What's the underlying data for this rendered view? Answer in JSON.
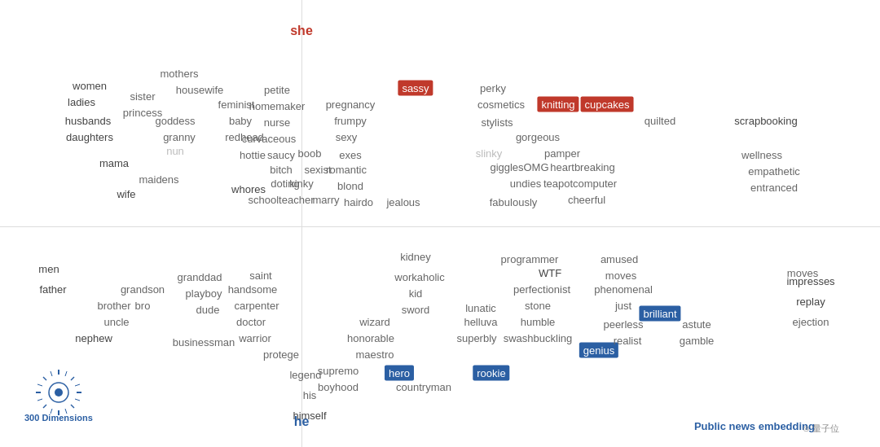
{
  "words": {
    "she": "she",
    "he": "he"
  },
  "watermark": {
    "label": "300\nDimensions"
  },
  "source": {
    "label": "Public news embedding"
  },
  "female_words": [
    "women",
    "ladies",
    "husbands",
    "daughters",
    "sister",
    "princess",
    "mama",
    "mothers",
    "housewife",
    "goddess",
    "granny",
    "nun",
    "maidens",
    "wife",
    "whores",
    "feminist",
    "baby",
    "redhead",
    "hottie",
    "petite",
    "homemaker",
    "nurse",
    "curvaceous",
    "saucy",
    "bitch",
    "doting",
    "schoolteacher",
    "sexist",
    "kinky",
    "marry",
    "pregnancy",
    "frumpy",
    "sexy",
    "exes",
    "romantic",
    "blond",
    "hairdo",
    "boob",
    "jealous",
    "sassy",
    "perky",
    "cosmetics",
    "knitting",
    "cupcakes",
    "stylists",
    "gorgeous",
    "slinky",
    "giggles",
    "OMG",
    "undies",
    "pamper",
    "heartbreaking",
    "teapot",
    "computer",
    "cheerful",
    "quilted",
    "scrapbooking",
    "wellness",
    "empathetic",
    "entranced",
    "fabulously"
  ],
  "male_words": [
    "men",
    "father",
    "brother",
    "uncle",
    "nephew",
    "grandson",
    "bro",
    "granddad",
    "playboy",
    "dude",
    "businessman",
    "saint",
    "handsome",
    "carpenter",
    "doctor",
    "warrior",
    "protege",
    "legend",
    "his",
    "himself",
    "boyhood",
    "supremo",
    "maestro",
    "honorable",
    "wizard",
    "hero",
    "kidney",
    "workaholic",
    "kid",
    "sword",
    "countryman",
    "rookie",
    "helluva",
    "superbly",
    "lunatic",
    "programmer",
    "WTF",
    "perfectionist",
    "stone",
    "humble",
    "swashbuckling",
    "brilliant",
    "genius",
    "amused",
    "moves",
    "phenomenal",
    "just",
    "peerless",
    "realist",
    "astute",
    "gamble",
    "impresses",
    "replay",
    "ejection"
  ]
}
